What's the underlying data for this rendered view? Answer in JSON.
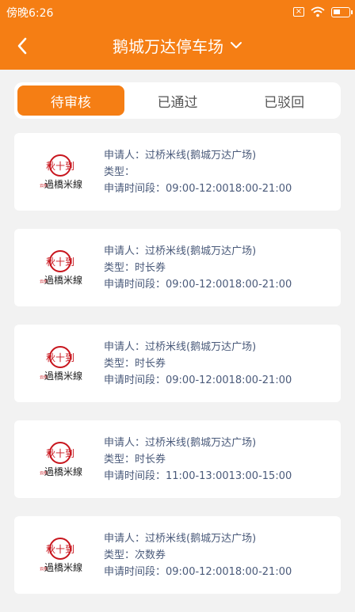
{
  "status_bar": {
    "time": "傍晚6:26"
  },
  "header": {
    "title": "鹅城万达停车场",
    "back_icon": "chevron-left-icon",
    "dropdown_icon": "chevron-down-icon"
  },
  "tabs": [
    {
      "label": "待审核",
      "active": true
    },
    {
      "label": "已通过",
      "active": false
    },
    {
      "label": "已驳回",
      "active": false
    }
  ],
  "colors": {
    "accent": "#f57e14",
    "text_info": "#4a5a7a",
    "background": "#f2f2f2",
    "logo_red": "#c8161e"
  },
  "requests": [
    {
      "applicant": "申请人：过桥米线(鹅城万达广场)",
      "type": "类型：",
      "period": "申请时间段：09:00-12:0018:00-21:00"
    },
    {
      "applicant": "申请人：过桥米线(鹅城万达广场)",
      "type": "类型：时长券",
      "period": "申请时间段：09:00-12:0018:00-21:00"
    },
    {
      "applicant": "申请人：过桥米线(鹅城万达广场)",
      "type": "类型：时长券",
      "period": "申请时间段：09:00-12:0018:00-21:00"
    },
    {
      "applicant": "申请人：过桥米线(鹅城万达广场)",
      "type": "类型：时长券",
      "period": "申请时间段：11:00-13:0013:00-15:00"
    },
    {
      "applicant": "申请人：过桥米线(鹅城万达广场)",
      "type": "类型：次数券",
      "period": "申请时间段：09:00-12:0018:00-21:00"
    }
  ],
  "logo": {
    "seal_text": "秋十到",
    "brand_text": "過橋米線",
    "small_text": "云南"
  }
}
